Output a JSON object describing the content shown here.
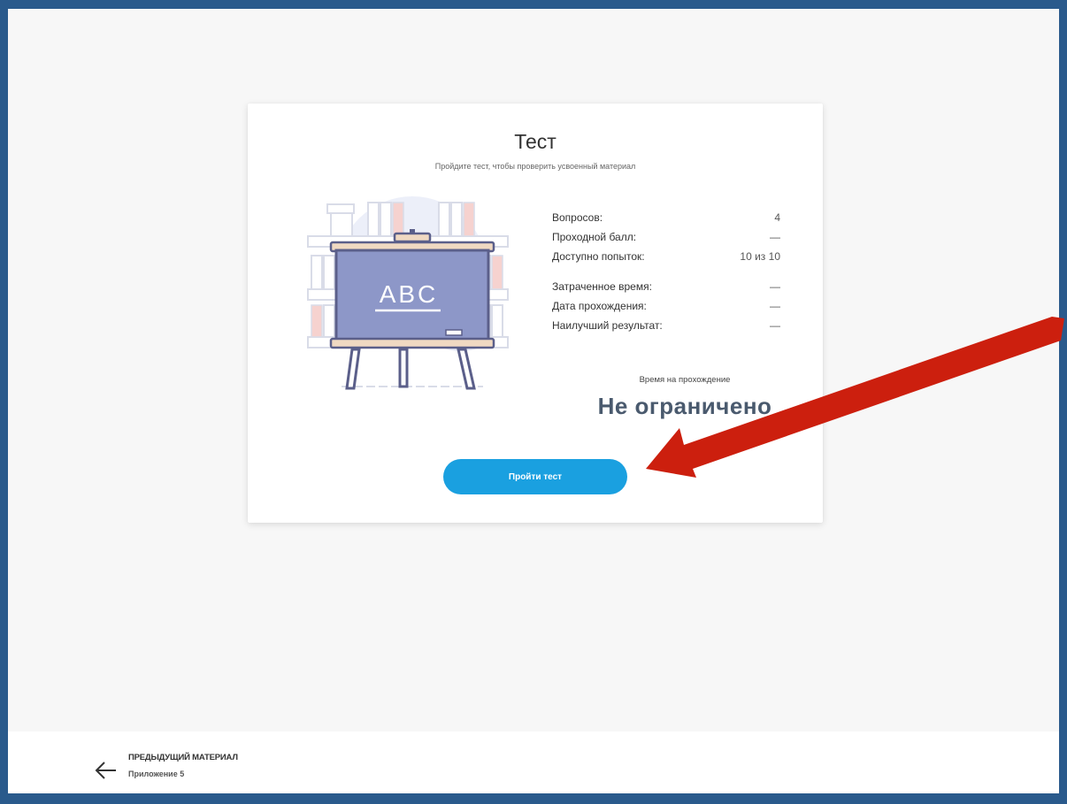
{
  "test_card": {
    "title": "Тест",
    "subtitle": "Пройдите тест, чтобы проверить усвоенный материал",
    "board_text": "ABC",
    "stats_group1": [
      {
        "label": "Вопросов:",
        "value": "4"
      },
      {
        "label": "Проходной балл:",
        "value": "—"
      },
      {
        "label": "Доступно попыток:",
        "value": "10 из 10"
      }
    ],
    "stats_group2": [
      {
        "label": "Затраченное время:",
        "value": "—"
      },
      {
        "label": "Дата прохождения:",
        "value": "—"
      },
      {
        "label": "Наилучший результат:",
        "value": "—"
      }
    ],
    "time_label": "Время на прохождение",
    "time_value": "Не ограничено",
    "start_button_label": "Пройти тест"
  },
  "footer": {
    "prev_title": "ПРЕДЫДУЩИЙ МАТЕРИАЛ",
    "prev_subtitle": "Приложение 5"
  },
  "colors": {
    "frame": "#2a5a8c",
    "button": "#1aa0e0",
    "annotation_arrow": "#cc1f0e"
  }
}
